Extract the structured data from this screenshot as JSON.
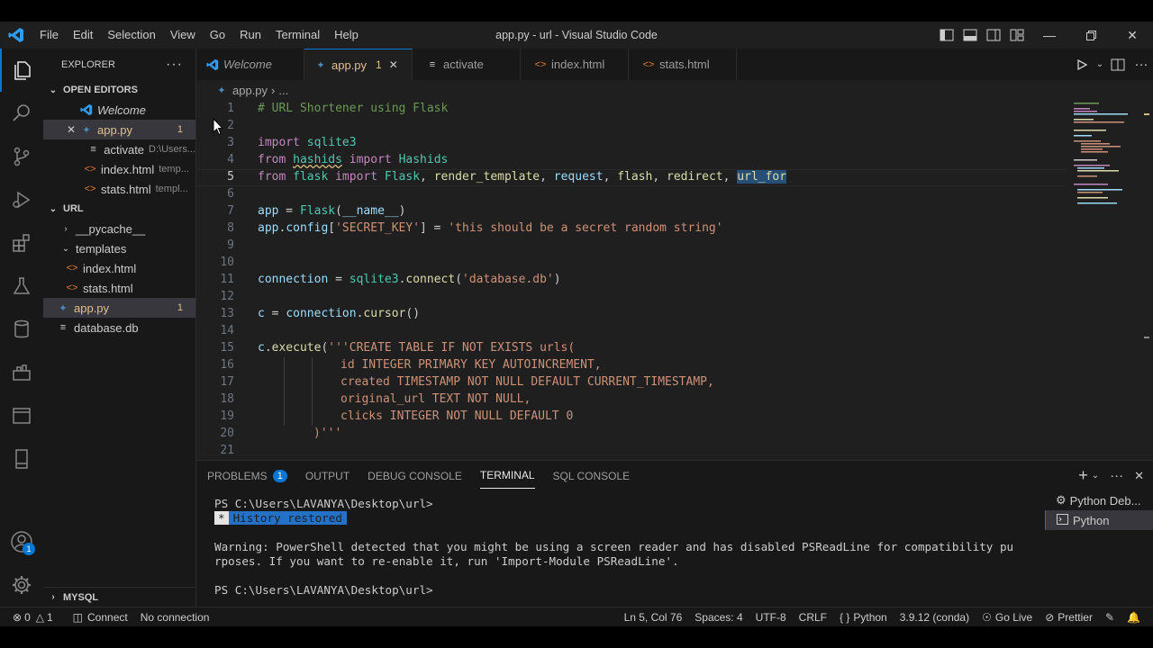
{
  "title_bar": {
    "menu": [
      "File",
      "Edit",
      "Selection",
      "View",
      "Go",
      "Run",
      "Terminal",
      "Help"
    ],
    "window_title": "app.py - url - Visual Studio Code"
  },
  "sidebar": {
    "header": "EXPLORER",
    "open_editors": {
      "title": "OPEN EDITORS",
      "items": [
        {
          "label": "Welcome",
          "desc": "",
          "count": ""
        },
        {
          "label": "app.py",
          "desc": "",
          "count": "1"
        },
        {
          "label": "activate",
          "desc": "D:\\Users...",
          "count": ""
        },
        {
          "label": "index.html",
          "desc": "temp...",
          "count": ""
        },
        {
          "label": "stats.html",
          "desc": "templ...",
          "count": ""
        }
      ]
    },
    "workspace": {
      "title": "URL",
      "items": [
        {
          "label": "__pycache__",
          "count": ""
        },
        {
          "label": "templates",
          "count": ""
        },
        {
          "label": "index.html",
          "count": ""
        },
        {
          "label": "stats.html",
          "count": ""
        },
        {
          "label": "app.py",
          "count": "1"
        },
        {
          "label": "database.db",
          "count": ""
        }
      ]
    },
    "mysql": "MYSQL"
  },
  "tabs": [
    {
      "label": "Welcome",
      "count": ""
    },
    {
      "label": "app.py",
      "count": "1"
    },
    {
      "label": "activate",
      "count": ""
    },
    {
      "label": "index.html",
      "count": ""
    },
    {
      "label": "stats.html",
      "count": ""
    }
  ],
  "breadcrumb": {
    "file": "app.py",
    "rest": "..."
  },
  "editor": {
    "line_numbers": [
      "1",
      "2",
      "3",
      "4",
      "5",
      "6",
      "7",
      "8",
      "9",
      "10",
      "11",
      "12",
      "13",
      "14",
      "15",
      "16",
      "17",
      "18",
      "19",
      "20",
      "21"
    ],
    "current_line": "5",
    "code": {
      "l1": "# URL Shortener using Flask",
      "l3_k": "import",
      "l3_m": " sqlite3",
      "l4_k1": "from",
      "l4_m": "hashids",
      "l4_k2": "import",
      "l4_c": "Hashids",
      "l5_k1": "from",
      "l5_m": "flask",
      "l5_k2": "import",
      "l5_c": "Flask",
      "l5_f1": "render_template",
      "l5_v1": "request",
      "l5_f2": "flash",
      "l5_f3": "redirect",
      "l5_f4": "url_for",
      "l7_v": "app",
      "l7_t": "Flask",
      "l7_n": "__name__",
      "l8_v": "app",
      "l8_a": "config",
      "l8_k": "'SECRET_KEY'",
      "l8_s": "'this should be a secret random string'",
      "l11_v": "connection",
      "l11_m": "sqlite3",
      "l11_f": "connect",
      "l11_s": "'database.db'",
      "l13_v": "c",
      "l13_v2": "connection",
      "l13_f": "cursor",
      "l15_v": "c",
      "l15_f": "execute",
      "l15_s": "'''CREATE TABLE IF NOT EXISTS urls(",
      "l16": "id INTEGER PRIMARY KEY AUTOINCREMENT,",
      "l17": "created TIMESTAMP NOT NULL DEFAULT CURRENT_TIMESTAMP,",
      "l18": "original_url TEXT NOT NULL,",
      "l19": "clicks INTEGER NOT NULL DEFAULT 0",
      "l20": ")'''"
    }
  },
  "panel": {
    "tabs": [
      "PROBLEMS",
      "OUTPUT",
      "DEBUG CONSOLE",
      "TERMINAL",
      "SQL CONSOLE"
    ],
    "problems_count": "1",
    "terminal_lines": {
      "prompt1": "PS C:\\Users\\LAVANYA\\Desktop\\url>",
      "history": "History restored",
      "history_star": "*",
      "warn1": "Warning: PowerShell detected that you might be using a screen reader and has disabled PSReadLine for compatibility pu",
      "warn2": "rposes. If you want to re-enable it, run 'Import-Module PSReadLine'.",
      "prompt2": "PS C:\\Users\\LAVANYA\\Desktop\\url>"
    },
    "terminal_list": [
      "Python Deb...",
      "Python"
    ]
  },
  "status_bar": {
    "errors": "0",
    "warnings": "1",
    "connect": "Connect",
    "no_connection": "No connection",
    "position": "Ln 5, Col 76",
    "spaces": "Spaces: 4",
    "encoding": "UTF-8",
    "eol": "CRLF",
    "language": "Python",
    "interpreter": "3.9.12 (conda)",
    "go_live": "Go Live",
    "prettier": "Prettier"
  },
  "accounts_badge": "1",
  "colors": {
    "accent": "#0078d4",
    "modified": "#e2c08d",
    "background": "#1f1f1f"
  }
}
